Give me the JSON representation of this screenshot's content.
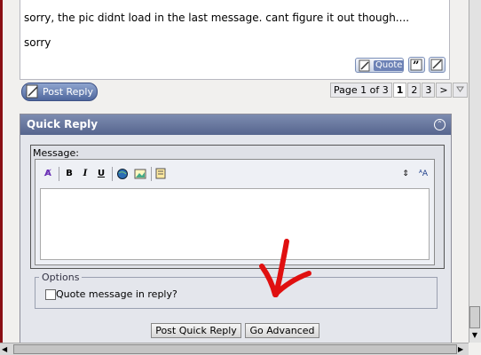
{
  "post": {
    "text": "sorry, the pic didnt load in the last message. cant figure it out though....",
    "signoff": "sorry"
  },
  "post_buttons": {
    "quote_label": "Quote"
  },
  "post_reply_label": "Post Reply",
  "pagination": {
    "label": "Page 1 of 3",
    "pages": [
      "1",
      "2",
      "3"
    ],
    "next": ">",
    "current": "1"
  },
  "quick_reply": {
    "title": "Quick Reply",
    "message_label": "Message:",
    "options_legend": "Options",
    "quote_checkbox_label": "Quote message in reply?",
    "post_button": "Post Quick Reply",
    "advanced_button": "Go Advanced"
  },
  "toolbar": {
    "bold": "B",
    "italic": "I",
    "underline": "U"
  },
  "colors": {
    "header": "#56658e",
    "annotation_arrow": "#e01010"
  }
}
